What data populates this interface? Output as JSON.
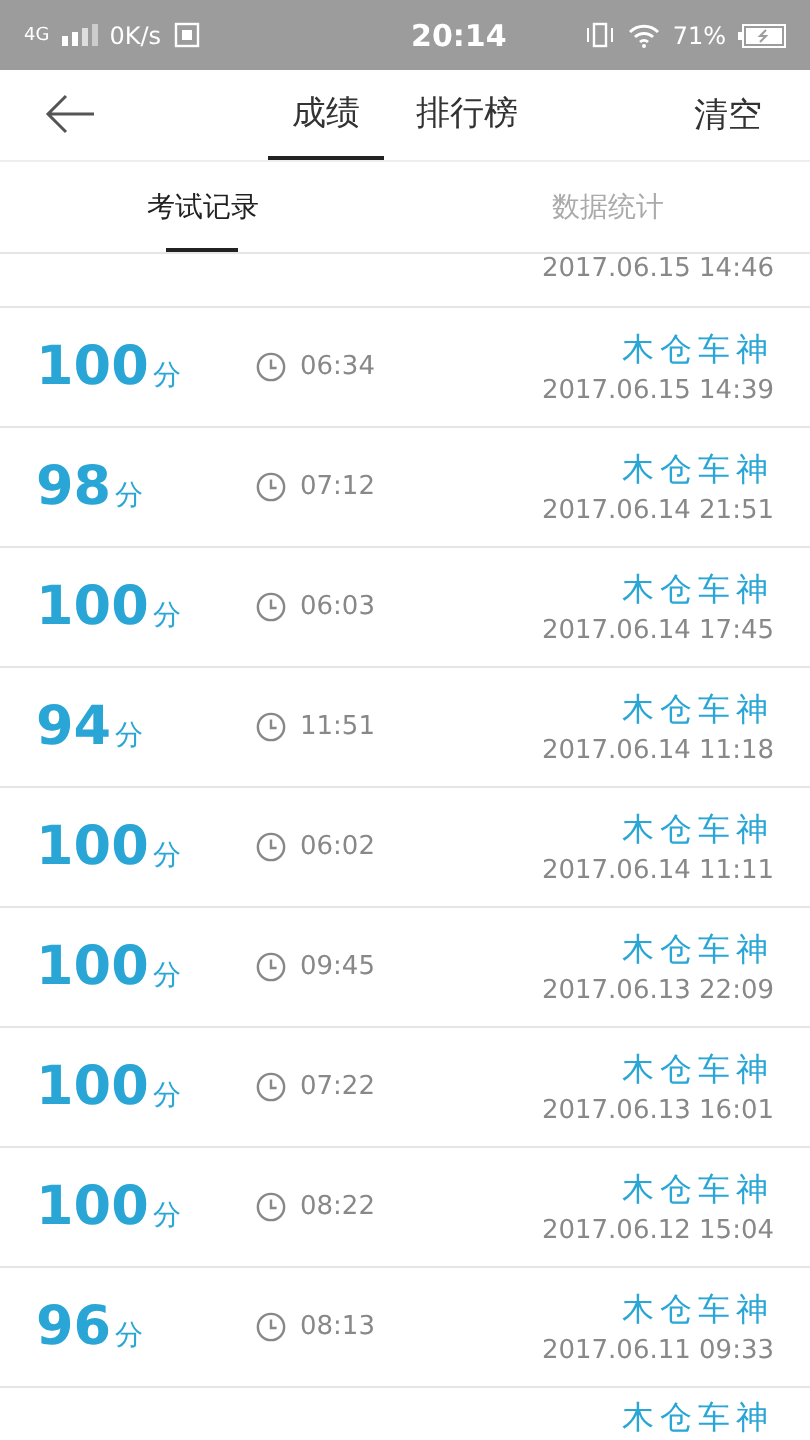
{
  "status_bar": {
    "network": "4G",
    "speed": "0K/s",
    "time": "20:14",
    "battery": "71%"
  },
  "header": {
    "tabs": [
      {
        "label": "成绩",
        "selected": true
      },
      {
        "label": "排行榜",
        "selected": false
      }
    ],
    "action": "清空"
  },
  "subtabs": [
    {
      "label": "考试记录",
      "selected": true
    },
    {
      "label": "数据统计",
      "selected": false
    }
  ],
  "records": [
    {
      "date": "2017.06.15  14:46"
    },
    {
      "score": "100",
      "unit": "分",
      "duration": "06:34",
      "title": "木仓车神",
      "date": "2017.06.15  14:39"
    },
    {
      "score": "98",
      "unit": "分",
      "duration": "07:12",
      "title": "木仓车神",
      "date": "2017.06.14  21:51"
    },
    {
      "score": "100",
      "unit": "分",
      "duration": "06:03",
      "title": "木仓车神",
      "date": "2017.06.14  17:45"
    },
    {
      "score": "94",
      "unit": "分",
      "duration": "11:51",
      "title": "木仓车神",
      "date": "2017.06.14  11:18"
    },
    {
      "score": "100",
      "unit": "分",
      "duration": "06:02",
      "title": "木仓车神",
      "date": "2017.06.14  11:11"
    },
    {
      "score": "100",
      "unit": "分",
      "duration": "09:45",
      "title": "木仓车神",
      "date": "2017.06.13  22:09"
    },
    {
      "score": "100",
      "unit": "分",
      "duration": "07:22",
      "title": "木仓车神",
      "date": "2017.06.13  16:01"
    },
    {
      "score": "100",
      "unit": "分",
      "duration": "08:22",
      "title": "木仓车神",
      "date": "2017.06.12  15:04"
    },
    {
      "score": "96",
      "unit": "分",
      "duration": "08:13",
      "title": "木仓车神",
      "date": "2017.06.11  09:33"
    },
    {
      "title": "木仓车神"
    }
  ]
}
